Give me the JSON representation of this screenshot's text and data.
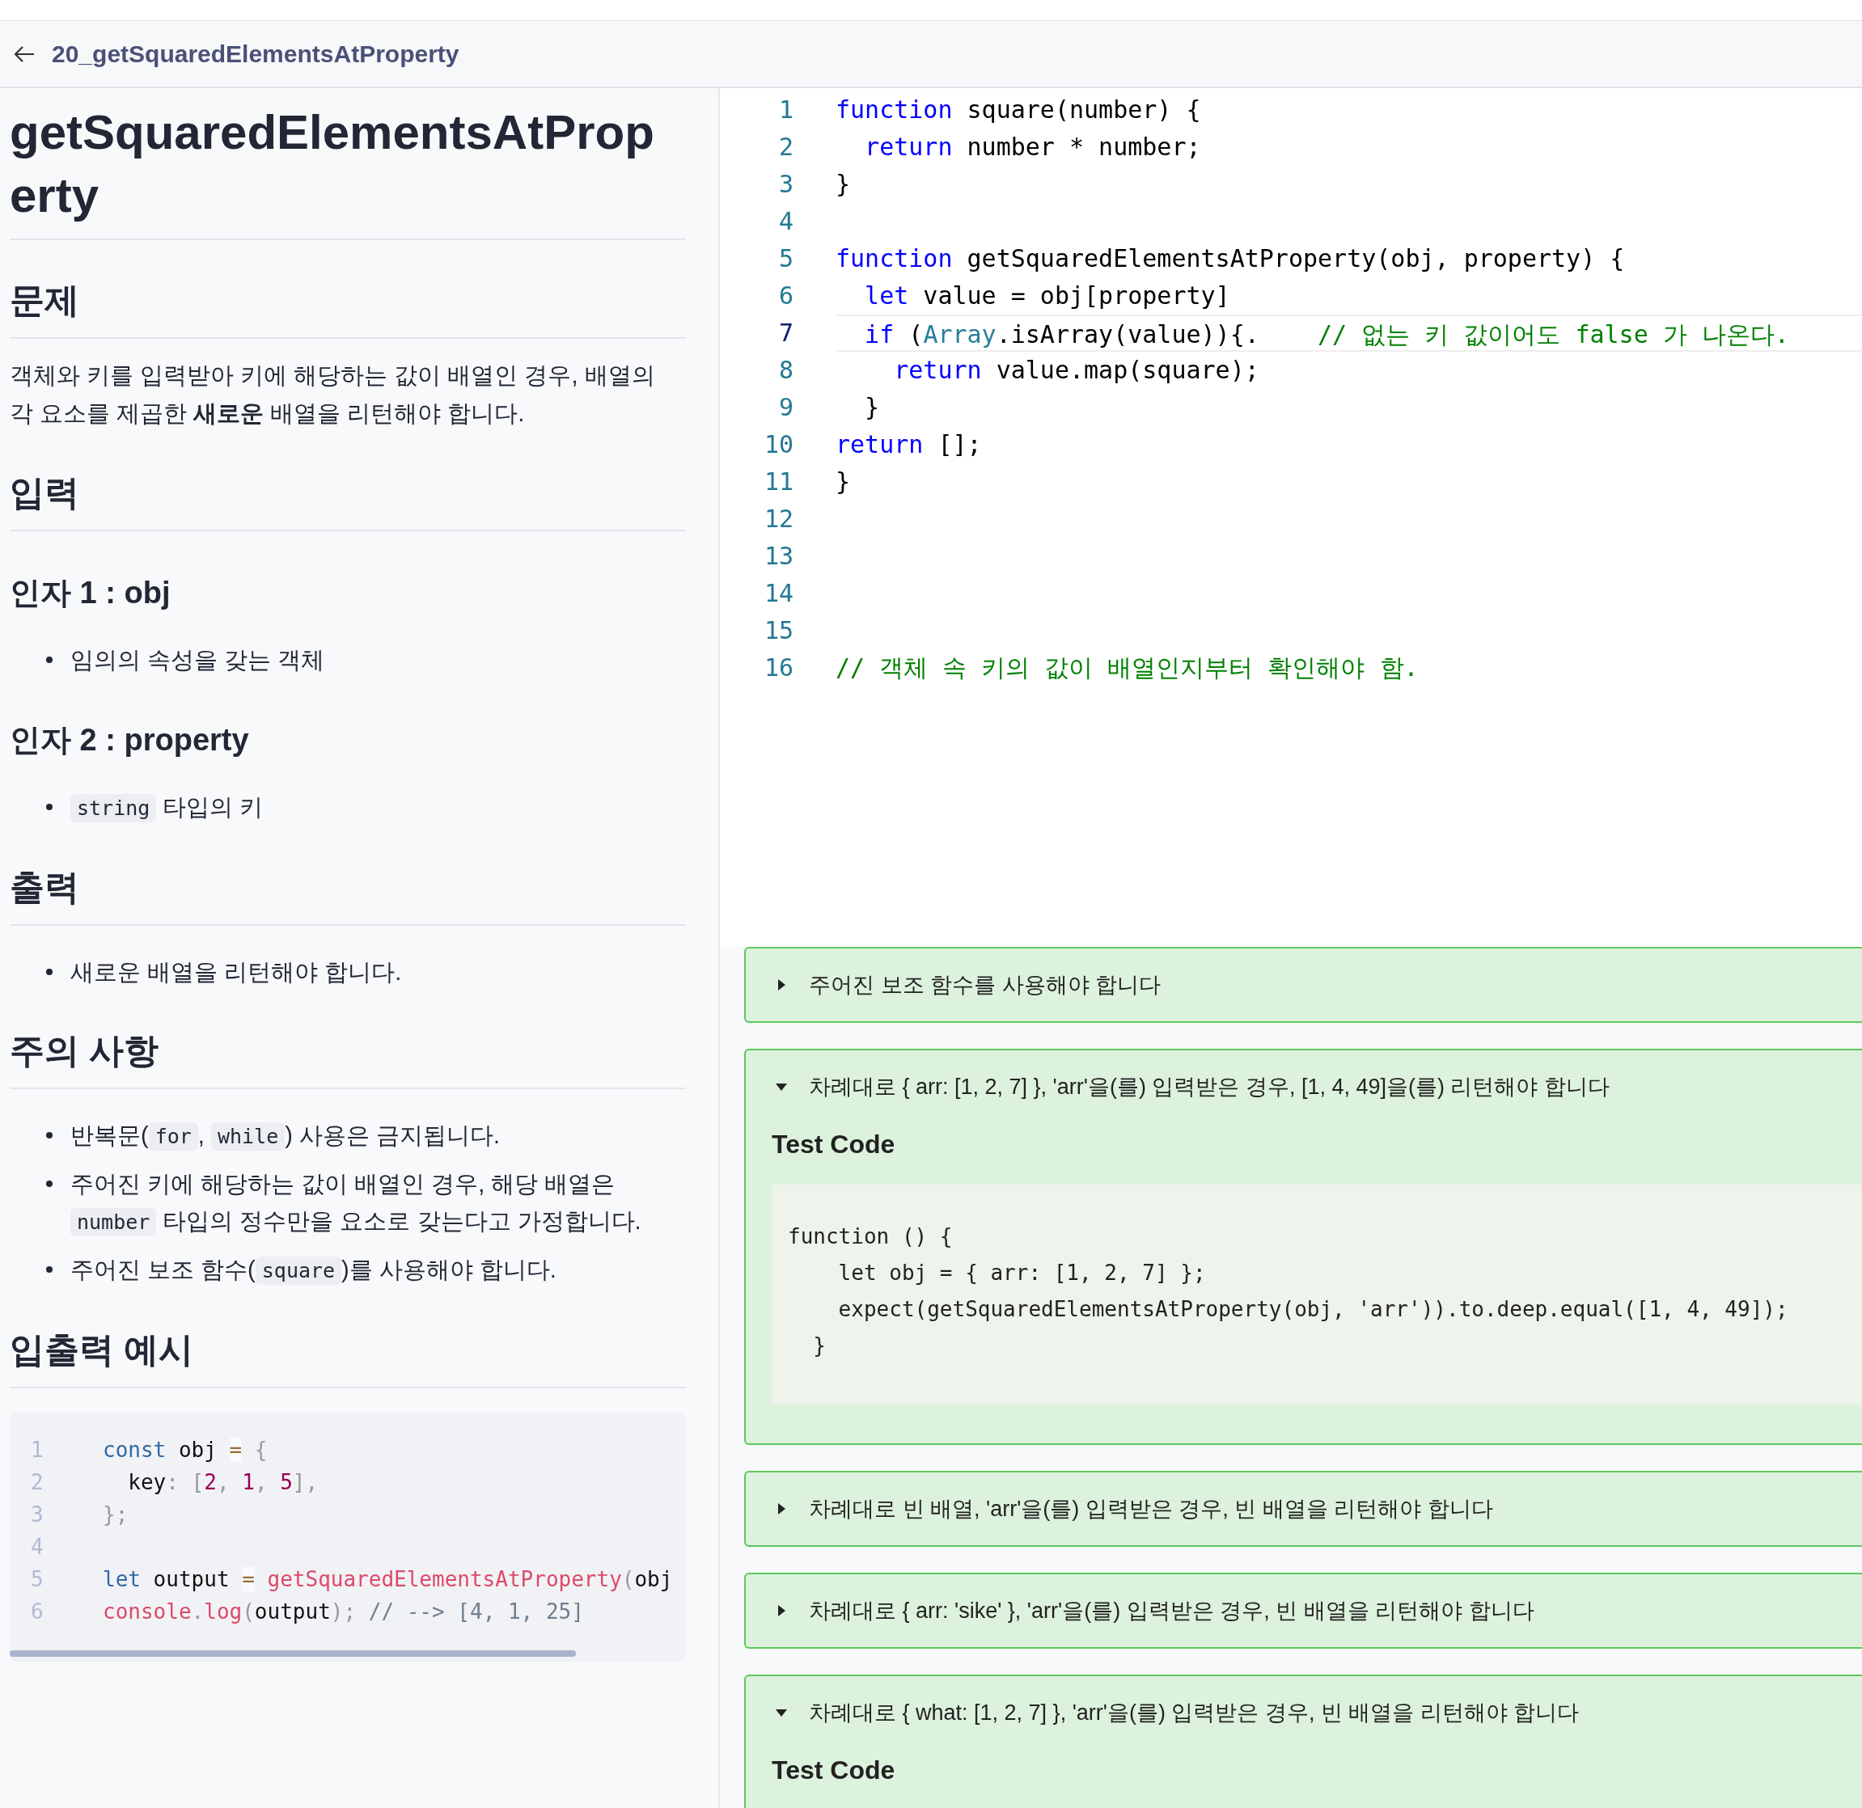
{
  "header": {
    "title": "20_getSquaredElementsAtProperty"
  },
  "problem": {
    "title": "getSquaredElementsAtProperty",
    "blocks": [
      {
        "kind": "h2",
        "text": "문제"
      },
      {
        "kind": "paragraph",
        "text": "객체와 키를 입력받아 키에 해당하는 값이 배열인 경우, 배열의 각 요소를 제곱한 **새로운** 배열을 리턴해야 합니다."
      },
      {
        "kind": "h2",
        "text": "입력"
      },
      {
        "kind": "h3",
        "text": "인자 1 : obj"
      },
      {
        "kind": "bullets",
        "items": [
          [
            {
              "kind": "text",
              "text": "임의의 속성을 갖는 객체"
            }
          ]
        ]
      },
      {
        "kind": "h3",
        "text": "인자 2 : property"
      },
      {
        "kind": "bullets",
        "items": [
          [
            {
              "kind": "code",
              "text": "string"
            },
            {
              "kind": "text",
              "text": " 타입의 키"
            }
          ]
        ]
      },
      {
        "kind": "h2",
        "text": "출력"
      },
      {
        "kind": "bullets",
        "items": [
          [
            {
              "kind": "text",
              "text": "새로운 배열을 리턴해야 합니다."
            }
          ]
        ]
      },
      {
        "kind": "h2",
        "text": "주의 사항"
      },
      {
        "kind": "bullets",
        "items": [
          [
            {
              "kind": "text",
              "text": "반복문("
            },
            {
              "kind": "code",
              "text": "for"
            },
            {
              "kind": "text",
              "text": ", "
            },
            {
              "kind": "code",
              "text": "while"
            },
            {
              "kind": "text",
              "text": ") 사용은 금지됩니다."
            }
          ],
          [
            {
              "kind": "text",
              "text": "주어진 키에 해당하는 값이 배열인 경우, 해당 배열은 "
            },
            {
              "kind": "code",
              "text": "number"
            },
            {
              "kind": "text",
              "text": " 타입의 정수만을 요소로 갖는다고 가정합니다."
            }
          ],
          [
            {
              "kind": "text",
              "text": "주어진 보조 함수("
            },
            {
              "kind": "code",
              "text": "square"
            },
            {
              "kind": "text",
              "text": ")를 사용해야 합니다."
            }
          ]
        ]
      },
      {
        "kind": "h2",
        "text": "입출력 예시"
      },
      {
        "kind": "code",
        "lines": [
          {
            "number": "1",
            "tokens": [
              {
                "kind": "kw",
                "t": "const"
              },
              {
                "kind": "plain",
                "t": " obj "
              },
              {
                "kind": "op",
                "t": "="
              },
              {
                "kind": "punct",
                "t": " {"
              }
            ]
          },
          {
            "number": "2",
            "tokens": [
              {
                "kind": "plain",
                "t": "  key"
              },
              {
                "kind": "punct",
                "t": ": ["
              },
              {
                "kind": "num",
                "t": "2"
              },
              {
                "kind": "punct",
                "t": ", "
              },
              {
                "kind": "num",
                "t": "1"
              },
              {
                "kind": "punct",
                "t": ", "
              },
              {
                "kind": "num",
                "t": "5"
              },
              {
                "kind": "punct",
                "t": "],"
              }
            ]
          },
          {
            "number": "3",
            "tokens": [
              {
                "kind": "punct",
                "t": "};"
              }
            ]
          },
          {
            "number": "4"
          },
          {
            "number": "5",
            "tokens": [
              {
                "kind": "kw",
                "t": "let"
              },
              {
                "kind": "plain",
                "t": " output "
              },
              {
                "kind": "op",
                "t": "="
              },
              {
                "kind": "fn",
                "t": " getSquaredElementsAtProperty"
              },
              {
                "kind": "punct",
                "t": "("
              },
              {
                "kind": "plain",
                "t": "obj"
              }
            ]
          },
          {
            "number": "6",
            "tokens": [
              {
                "kind": "fn",
                "t": "console"
              },
              {
                "kind": "punct",
                "t": "."
              },
              {
                "kind": "fn",
                "t": "log"
              },
              {
                "kind": "punct",
                "t": "("
              },
              {
                "kind": "plain",
                "t": "output"
              },
              {
                "kind": "punct",
                "t": ");"
              },
              {
                "kind": "comment",
                "t": " // --> [4, 1, 25]"
              }
            ]
          }
        ]
      }
    ]
  },
  "editor": {
    "lines": [
      {
        "number": "1",
        "current": false,
        "tokens": [
          {
            "kind": "kw",
            "t": "function"
          },
          {
            "kind": "plain",
            "t": " square(number) {"
          }
        ]
      },
      {
        "number": "2",
        "current": false,
        "tokens": [
          {
            "kind": "kw",
            "t": "  return"
          },
          {
            "kind": "plain",
            "t": " number * number;"
          }
        ]
      },
      {
        "number": "3",
        "current": false,
        "tokens": [
          {
            "kind": "plain",
            "t": "}"
          }
        ]
      },
      {
        "number": "4",
        "current": false
      },
      {
        "number": "5",
        "current": false,
        "tokens": [
          {
            "kind": "kw",
            "t": "function"
          },
          {
            "kind": "plain",
            "t": " getSquaredElementsAtProperty(obj, property) {"
          }
        ]
      },
      {
        "number": "6",
        "current": false,
        "tokens": [
          {
            "kind": "kw",
            "t": "  let"
          },
          {
            "kind": "plain",
            "t": " value = obj[property]"
          }
        ]
      },
      {
        "number": "7",
        "current": true,
        "tokens": [
          {
            "kind": "kw",
            "t": "  if"
          },
          {
            "kind": "plain",
            "t": " ("
          },
          {
            "kind": "type",
            "t": "Array"
          },
          {
            "kind": "plain",
            "t": ".isArray(value)){."
          },
          {
            "kind": "comment",
            "t": "    // 없는 키 값이어도 false 가 나온다."
          }
        ]
      },
      {
        "number": "8",
        "current": false,
        "tokens": [
          {
            "kind": "kw",
            "t": "    return"
          },
          {
            "kind": "plain",
            "t": " value.map(square);"
          }
        ]
      },
      {
        "number": "9",
        "current": false,
        "tokens": [
          {
            "kind": "plain",
            "t": "  }"
          }
        ]
      },
      {
        "number": "10",
        "current": false,
        "tokens": [
          {
            "kind": "kw",
            "t": "return"
          },
          {
            "kind": "plain",
            "t": " [];"
          }
        ]
      },
      {
        "number": "11",
        "current": false,
        "tokens": [
          {
            "kind": "plain",
            "t": "}"
          }
        ]
      },
      {
        "number": "12",
        "current": false
      },
      {
        "number": "13",
        "current": false
      },
      {
        "number": "14",
        "current": false
      },
      {
        "number": "15",
        "current": false
      },
      {
        "number": "16",
        "current": false,
        "tokens": [
          {
            "kind": "comment",
            "t": "// 객체 속 키의 값이 배열인지부터 확인해야 함."
          }
        ]
      }
    ]
  },
  "test_cases": [
    {
      "title": "주어진 보조 함수를 사용해야 합니다",
      "expanded": false
    },
    {
      "title": "차례대로 { arr: [1, 2, 7] }, 'arr'을(를) 입력받은 경우, [1, 4, 49]을(를) 리턴해야 합니다",
      "expanded": true,
      "heading": "Test Code",
      "code": [
        "function () {",
        "    let obj = { arr: [1, 2, 7] };",
        "    expect(getSquaredElementsAtProperty(obj, 'arr')).to.deep.equal([1, 4, 49]);",
        "  }"
      ]
    },
    {
      "title": "차례대로 빈 배열, 'arr'을(를) 입력받은 경우, 빈 배열을 리턴해야 합니다",
      "expanded": false
    },
    {
      "title": "차례대로 { arr: 'sike' }, 'arr'을(를) 입력받은 경우, 빈 배열을 리턴해야 합니다",
      "expanded": false
    },
    {
      "title": "차례대로 { what: [1, 2, 7] }, 'arr'을(를) 입력받은 경우, 빈 배열을 리턴해야 합니다",
      "expanded": true,
      "heading": "Test Code"
    }
  ]
}
